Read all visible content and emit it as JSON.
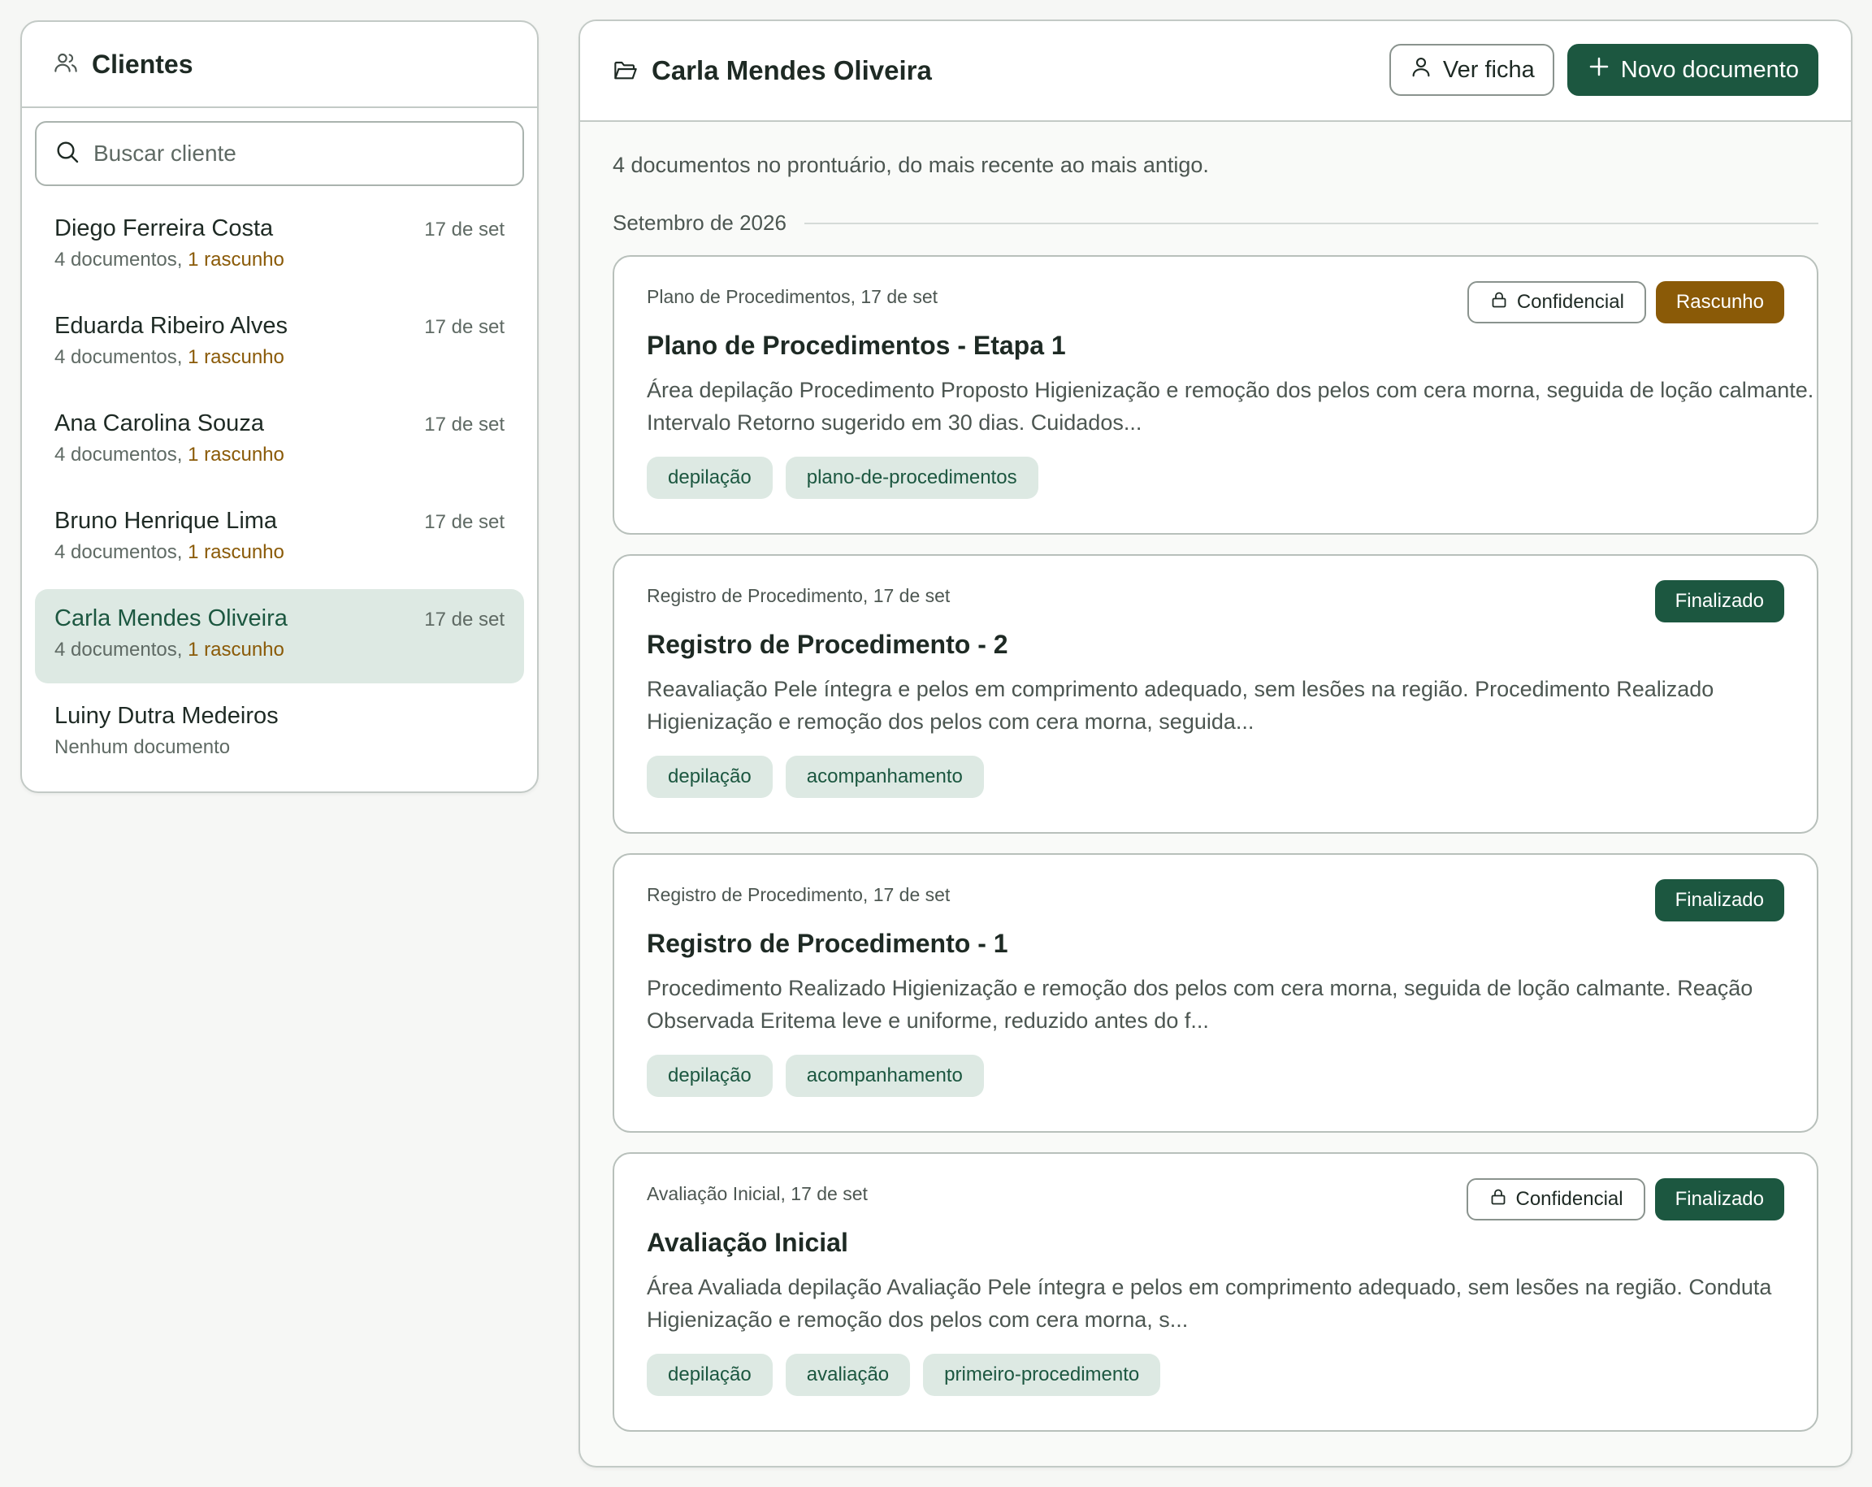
{
  "sidebar": {
    "title": "Clientes",
    "search_placeholder": "Buscar cliente",
    "clients": [
      {
        "name": "Diego Ferreira Costa",
        "date": "17 de set",
        "docs": "4 documentos,",
        "drafts": "1 rascunho"
      },
      {
        "name": "Eduarda Ribeiro Alves",
        "date": "17 de set",
        "docs": "4 documentos,",
        "drafts": "1 rascunho"
      },
      {
        "name": "Ana Carolina Souza",
        "date": "17 de set",
        "docs": "4 documentos,",
        "drafts": "1 rascunho"
      },
      {
        "name": "Bruno Henrique Lima",
        "date": "17 de set",
        "docs": "4 documentos,",
        "drafts": "1 rascunho"
      },
      {
        "name": "Carla Mendes Oliveira",
        "date": "17 de set",
        "docs": "4 documentos,",
        "drafts": "1 rascunho",
        "selected": true
      },
      {
        "name": "Luiny Dutra Medeiros",
        "date": "",
        "docs": "Nenhum documento",
        "drafts": ""
      }
    ]
  },
  "main": {
    "title": "Carla Mendes Oliveira",
    "view_button": "Ver ficha",
    "new_button": "Novo documento",
    "summary": "4 documentos no prontuário, do mais recente ao mais antigo.",
    "month": "Setembro de 2026",
    "documents": [
      {
        "meta": "Plano de Procedimentos, 17 de set",
        "title": "Plano de Procedimentos - Etapa 1",
        "excerpt": "Área depilação Procedimento Proposto Higienização e remoção dos pelos com cera morna, seguida de loção calmante. Intervalo Retorno sugerido em 30 dias. Cuidados...",
        "confidential": "Confidencial",
        "status": "Rascunho",
        "tags": [
          "depilação",
          "plano-de-procedimentos"
        ]
      },
      {
        "meta": "Registro de Procedimento, 17 de set",
        "title": "Registro de Procedimento - 2",
        "excerpt": "Reavaliação Pele íntegra e pelos em comprimento adequado, sem lesões na região. Procedimento Realizado Higienização e remoção dos pelos com cera morna, seguida...",
        "confidential": "",
        "status": "Finalizado",
        "tags": [
          "depilação",
          "acompanhamento"
        ]
      },
      {
        "meta": "Registro de Procedimento, 17 de set",
        "title": "Registro de Procedimento - 1",
        "excerpt": "Procedimento Realizado Higienização e remoção dos pelos com cera morna, seguida de loção calmante. Reação Observada Eritema leve e uniforme, reduzido antes do f...",
        "confidential": "",
        "status": "Finalizado",
        "tags": [
          "depilação",
          "acompanhamento"
        ]
      },
      {
        "meta": "Avaliação Inicial, 17 de set",
        "title": "Avaliação Inicial",
        "excerpt": "Área Avaliada depilação Avaliação Pele íntegra e pelos em comprimento adequado, sem lesões na região. Conduta Higienização e remoção dos pelos com cera morna, s...",
        "confidential": "Confidencial",
        "status": "Finalizado",
        "tags": [
          "depilação",
          "avaliação",
          "primeiro-procedimento"
        ]
      }
    ]
  },
  "colors": {
    "accent": "#1c5740",
    "draft": "#8a5a07",
    "selected_bg": "#dde9e3",
    "border": "#c3cac6"
  },
  "icons": {
    "sidebar_header": "users-icon",
    "search": "search-icon",
    "main_header": "folder-open-icon",
    "view_button": "user-icon",
    "new_button": "plus-icon",
    "confidential": "lock-icon"
  }
}
